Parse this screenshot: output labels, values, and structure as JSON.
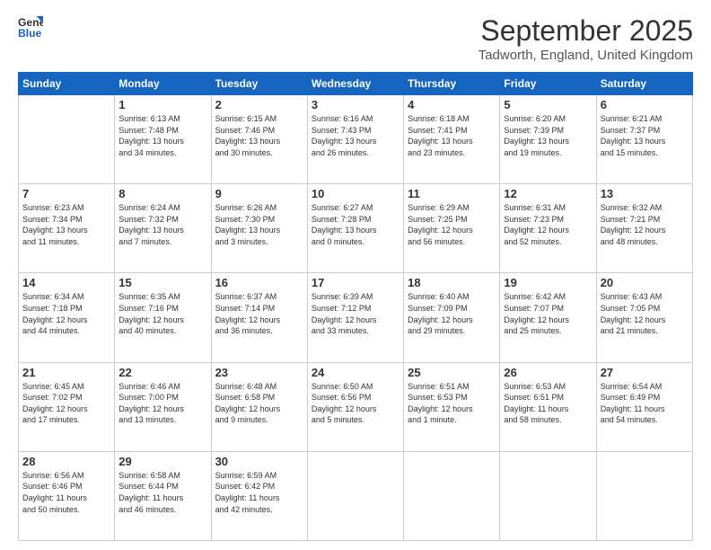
{
  "logo": {
    "general": "General",
    "blue": "Blue"
  },
  "header": {
    "month": "September 2025",
    "location": "Tadworth, England, United Kingdom"
  },
  "weekdays": [
    "Sunday",
    "Monday",
    "Tuesday",
    "Wednesday",
    "Thursday",
    "Friday",
    "Saturday"
  ],
  "weeks": [
    [
      {
        "day": "",
        "info": ""
      },
      {
        "day": "1",
        "info": "Sunrise: 6:13 AM\nSunset: 7:48 PM\nDaylight: 13 hours\nand 34 minutes."
      },
      {
        "day": "2",
        "info": "Sunrise: 6:15 AM\nSunset: 7:46 PM\nDaylight: 13 hours\nand 30 minutes."
      },
      {
        "day": "3",
        "info": "Sunrise: 6:16 AM\nSunset: 7:43 PM\nDaylight: 13 hours\nand 26 minutes."
      },
      {
        "day": "4",
        "info": "Sunrise: 6:18 AM\nSunset: 7:41 PM\nDaylight: 13 hours\nand 23 minutes."
      },
      {
        "day": "5",
        "info": "Sunrise: 6:20 AM\nSunset: 7:39 PM\nDaylight: 13 hours\nand 19 minutes."
      },
      {
        "day": "6",
        "info": "Sunrise: 6:21 AM\nSunset: 7:37 PM\nDaylight: 13 hours\nand 15 minutes."
      }
    ],
    [
      {
        "day": "7",
        "info": "Sunrise: 6:23 AM\nSunset: 7:34 PM\nDaylight: 13 hours\nand 11 minutes."
      },
      {
        "day": "8",
        "info": "Sunrise: 6:24 AM\nSunset: 7:32 PM\nDaylight: 13 hours\nand 7 minutes."
      },
      {
        "day": "9",
        "info": "Sunrise: 6:26 AM\nSunset: 7:30 PM\nDaylight: 13 hours\nand 3 minutes."
      },
      {
        "day": "10",
        "info": "Sunrise: 6:27 AM\nSunset: 7:28 PM\nDaylight: 13 hours\nand 0 minutes."
      },
      {
        "day": "11",
        "info": "Sunrise: 6:29 AM\nSunset: 7:25 PM\nDaylight: 12 hours\nand 56 minutes."
      },
      {
        "day": "12",
        "info": "Sunrise: 6:31 AM\nSunset: 7:23 PM\nDaylight: 12 hours\nand 52 minutes."
      },
      {
        "day": "13",
        "info": "Sunrise: 6:32 AM\nSunset: 7:21 PM\nDaylight: 12 hours\nand 48 minutes."
      }
    ],
    [
      {
        "day": "14",
        "info": "Sunrise: 6:34 AM\nSunset: 7:18 PM\nDaylight: 12 hours\nand 44 minutes."
      },
      {
        "day": "15",
        "info": "Sunrise: 6:35 AM\nSunset: 7:16 PM\nDaylight: 12 hours\nand 40 minutes."
      },
      {
        "day": "16",
        "info": "Sunrise: 6:37 AM\nSunset: 7:14 PM\nDaylight: 12 hours\nand 36 minutes."
      },
      {
        "day": "17",
        "info": "Sunrise: 6:39 AM\nSunset: 7:12 PM\nDaylight: 12 hours\nand 33 minutes."
      },
      {
        "day": "18",
        "info": "Sunrise: 6:40 AM\nSunset: 7:09 PM\nDaylight: 12 hours\nand 29 minutes."
      },
      {
        "day": "19",
        "info": "Sunrise: 6:42 AM\nSunset: 7:07 PM\nDaylight: 12 hours\nand 25 minutes."
      },
      {
        "day": "20",
        "info": "Sunrise: 6:43 AM\nSunset: 7:05 PM\nDaylight: 12 hours\nand 21 minutes."
      }
    ],
    [
      {
        "day": "21",
        "info": "Sunrise: 6:45 AM\nSunset: 7:02 PM\nDaylight: 12 hours\nand 17 minutes."
      },
      {
        "day": "22",
        "info": "Sunrise: 6:46 AM\nSunset: 7:00 PM\nDaylight: 12 hours\nand 13 minutes."
      },
      {
        "day": "23",
        "info": "Sunrise: 6:48 AM\nSunset: 6:58 PM\nDaylight: 12 hours\nand 9 minutes."
      },
      {
        "day": "24",
        "info": "Sunrise: 6:50 AM\nSunset: 6:56 PM\nDaylight: 12 hours\nand 5 minutes."
      },
      {
        "day": "25",
        "info": "Sunrise: 6:51 AM\nSunset: 6:53 PM\nDaylight: 12 hours\nand 1 minute."
      },
      {
        "day": "26",
        "info": "Sunrise: 6:53 AM\nSunset: 6:51 PM\nDaylight: 11 hours\nand 58 minutes."
      },
      {
        "day": "27",
        "info": "Sunrise: 6:54 AM\nSunset: 6:49 PM\nDaylight: 11 hours\nand 54 minutes."
      }
    ],
    [
      {
        "day": "28",
        "info": "Sunrise: 6:56 AM\nSunset: 6:46 PM\nDaylight: 11 hours\nand 50 minutes."
      },
      {
        "day": "29",
        "info": "Sunrise: 6:58 AM\nSunset: 6:44 PM\nDaylight: 11 hours\nand 46 minutes."
      },
      {
        "day": "30",
        "info": "Sunrise: 6:59 AM\nSunset: 6:42 PM\nDaylight: 11 hours\nand 42 minutes."
      },
      {
        "day": "",
        "info": ""
      },
      {
        "day": "",
        "info": ""
      },
      {
        "day": "",
        "info": ""
      },
      {
        "day": "",
        "info": ""
      }
    ]
  ]
}
